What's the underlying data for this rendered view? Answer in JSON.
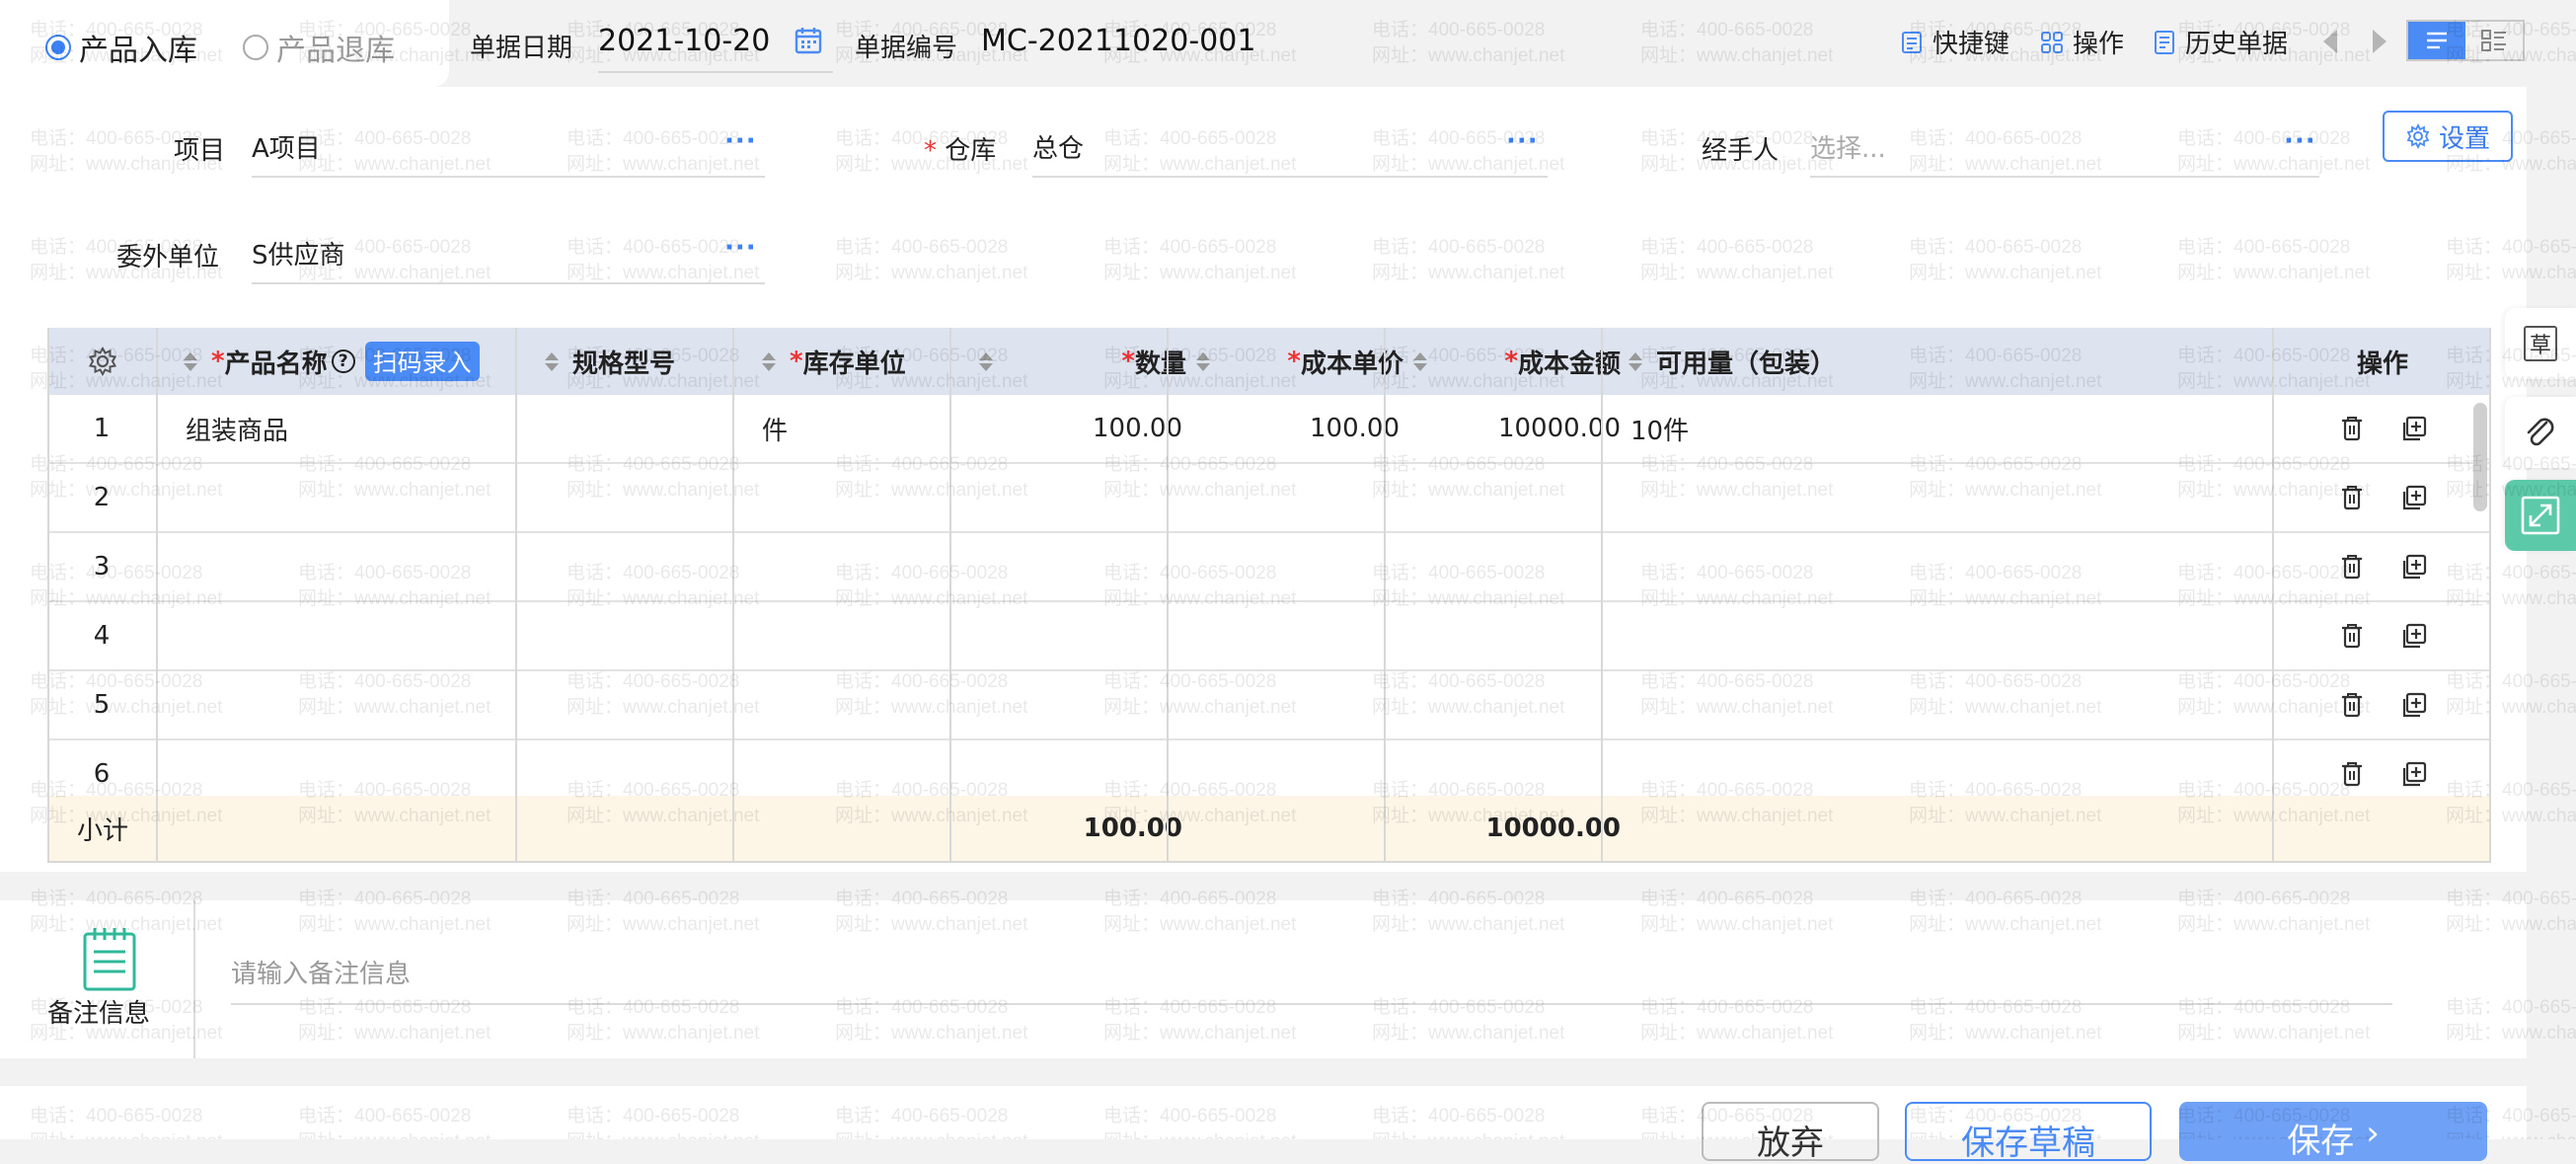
{
  "topbar": {
    "radio_in": "产品入库",
    "radio_out": "产品退库",
    "date_label": "单据日期",
    "date_value": "2021-10-20",
    "code_label": "单据编号",
    "code_value": "MC-20211020-001",
    "shortcut": "快捷键",
    "operate": "操作",
    "history": "历史单据"
  },
  "form": {
    "project_label": "项目",
    "project_value": "A项目",
    "warehouse_label": "仓库",
    "warehouse_value": "总仓",
    "handler_label": "经手人",
    "handler_placeholder": "选择...",
    "outsource_label": "委外单位",
    "outsource_value": "S供应商",
    "settings": "设置",
    "dots": "···"
  },
  "table": {
    "headers": {
      "product": "产品名称",
      "scan": "扫码录入",
      "spec": "规格型号",
      "unit": "库存单位",
      "qty": "数量",
      "price": "成本单价",
      "amount": "成本金额",
      "available": "可用量（包装）",
      "op": "操作"
    },
    "rows": [
      {
        "no": "1",
        "product": "组装商品",
        "spec": "",
        "unit": "件",
        "qty": "100.00",
        "price": "100.00",
        "amount": "10000.00",
        "available": "10件"
      },
      {
        "no": "2",
        "product": "",
        "spec": "",
        "unit": "",
        "qty": "",
        "price": "",
        "amount": "",
        "available": ""
      },
      {
        "no": "3",
        "product": "",
        "spec": "",
        "unit": "",
        "qty": "",
        "price": "",
        "amount": "",
        "available": ""
      },
      {
        "no": "4",
        "product": "",
        "spec": "",
        "unit": "",
        "qty": "",
        "price": "",
        "amount": "",
        "available": ""
      },
      {
        "no": "5",
        "product": "",
        "spec": "",
        "unit": "",
        "qty": "",
        "price": "",
        "amount": "",
        "available": ""
      },
      {
        "no": "6",
        "product": "",
        "spec": "",
        "unit": "",
        "qty": "",
        "price": "",
        "amount": "",
        "available": ""
      }
    ],
    "subtotal": {
      "label": "小计",
      "qty": "100.00",
      "amount": "10000.00"
    }
  },
  "remark": {
    "label": "备注信息",
    "placeholder": "请输入备注信息"
  },
  "footer": {
    "discard": "放弃",
    "save_draft": "保存草稿",
    "save": "保存"
  },
  "side": {
    "draft": "草"
  },
  "watermark": {
    "phone": "电话：400-665-0028",
    "site": "网址：www.chanjet.net"
  },
  "colors": {
    "accent": "#4a8bf5",
    "required": "#e33333",
    "side_green": "#5ccaa8",
    "subtotal_bg": "#fdf5e6"
  }
}
